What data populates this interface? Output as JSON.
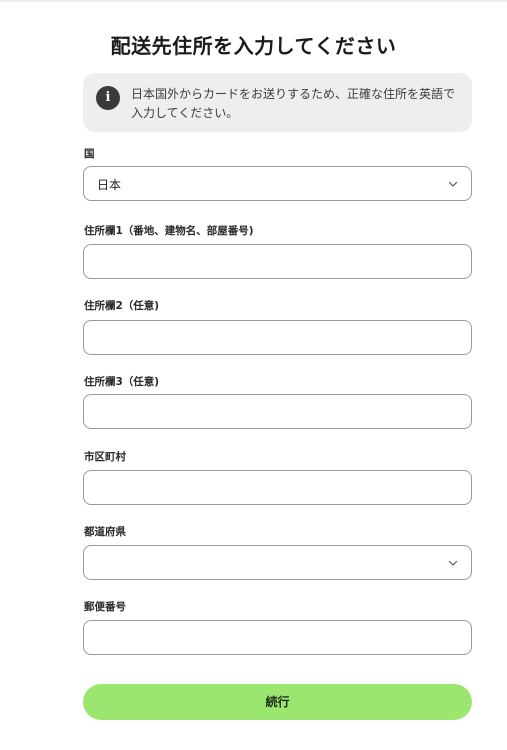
{
  "page": {
    "title": "配送先住所を入力してください"
  },
  "notice": {
    "icon": "info-icon",
    "icon_glyph": "i",
    "text": "日本国外からカードをお送りするため、正確な住所を英語で入力してください。"
  },
  "form": {
    "country": {
      "label": "国",
      "value": "日本"
    },
    "address1": {
      "label": "住所欄1（番地、建物名、部屋番号)",
      "value": ""
    },
    "address2": {
      "label": "住所欄2（任意)",
      "value": ""
    },
    "address3": {
      "label": "住所欄3（任意)",
      "value": ""
    },
    "city": {
      "label": "市区町村",
      "value": ""
    },
    "prefecture": {
      "label": "都道府県",
      "value": ""
    },
    "postal_code": {
      "label": "郵便番号",
      "value": ""
    },
    "submit_label": "続行"
  },
  "colors": {
    "accent_button": "#9be66e",
    "notice_background": "#eeefec",
    "field_border": "#9a9a9a"
  }
}
